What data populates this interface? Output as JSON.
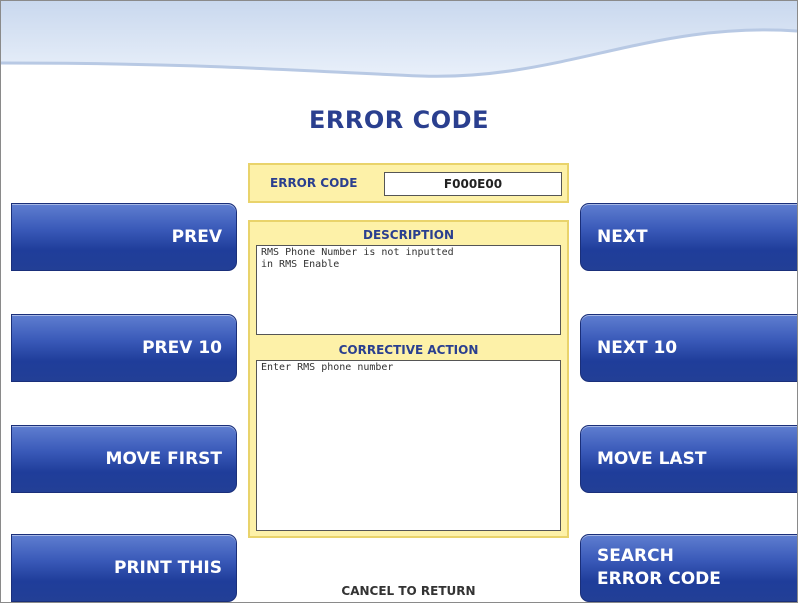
{
  "page": {
    "title": "ERROR CODE",
    "footer": "CANCEL TO RETURN"
  },
  "error": {
    "code_label": "ERROR CODE",
    "code_value": "F000E00",
    "description_title": "DESCRIPTION",
    "description_lines": [
      "RMS Phone Number is not inputted",
      "in RMS Enable"
    ],
    "corrective_title": "CORRECTIVE ACTION",
    "corrective_lines": [
      "Enter RMS phone number"
    ]
  },
  "left_buttons": [
    {
      "label": "PREV"
    },
    {
      "label": "PREV 10"
    },
    {
      "label": "MOVE FIRST"
    },
    {
      "label": "PRINT THIS"
    }
  ],
  "right_buttons": [
    {
      "label": "NEXT"
    },
    {
      "label": "NEXT 10"
    },
    {
      "label": "MOVE LAST"
    },
    {
      "label_line1": "SEARCH",
      "label_line2": "ERROR CODE"
    }
  ],
  "colors": {
    "title": "#2a3f8f",
    "button": "#2e4fae",
    "panel": "#fdf1a8",
    "panel_border": "#e9d36b"
  }
}
